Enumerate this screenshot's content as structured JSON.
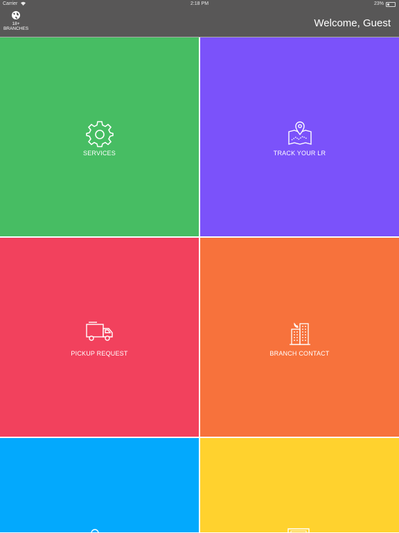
{
  "status_bar": {
    "carrier": "Carrier",
    "time": "2:18 PM",
    "battery": "23%"
  },
  "header": {
    "branches_count": "18+",
    "branches_label": "BRANCHES",
    "welcome_text": "Welcome, Guest"
  },
  "tiles": [
    {
      "label": "SERVICES",
      "color": "#47bd63",
      "icon": "gear-icon"
    },
    {
      "label": "TRACK YOUR LR",
      "color": "#7b52fa",
      "icon": "map-pin-icon"
    },
    {
      "label": "PICKUP REQUEST",
      "color": "#f2415d",
      "icon": "truck-icon"
    },
    {
      "label": "BRANCH CONTACT",
      "color": "#f7723c",
      "icon": "building-icon"
    },
    {
      "label": "",
      "color": "#03a9fd",
      "icon": "pin-icon"
    },
    {
      "label": "",
      "color": "#ffd22e",
      "icon": "document-icon"
    }
  ]
}
